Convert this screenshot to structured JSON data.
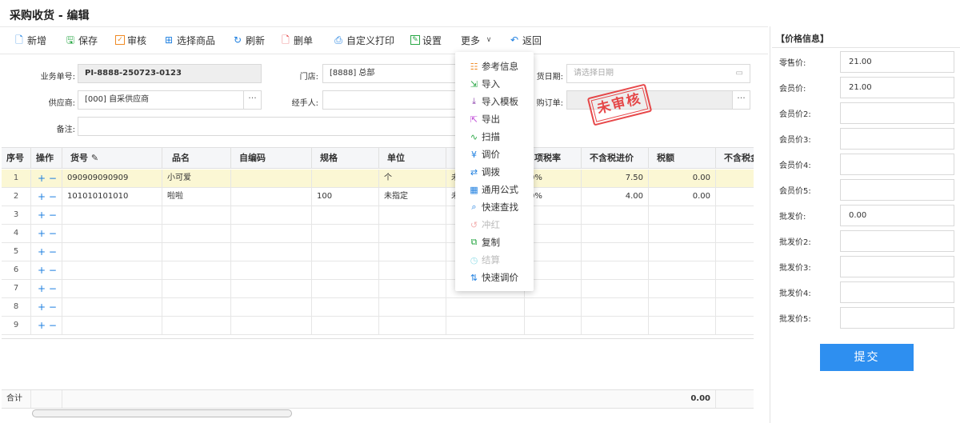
{
  "title": "采购收货 - 编辑",
  "toolbar": [
    {
      "label": "新增",
      "icon": "new-doc-icon",
      "color": "#1e7fe0"
    },
    {
      "label": "保存",
      "icon": "save-icon",
      "color": "#29a745"
    },
    {
      "label": "审核",
      "icon": "check-icon",
      "color": "#f08a24"
    },
    {
      "label": "选择商品",
      "icon": "cart-icon",
      "color": "#1e7fe0"
    },
    {
      "label": "刷新",
      "icon": "refresh-icon",
      "color": "#1e7fe0"
    },
    {
      "label": "删单",
      "icon": "delete-doc-icon",
      "color": "#e5393b"
    },
    {
      "label": "自定义打印",
      "icon": "print-icon",
      "color": "#1e7fe0"
    },
    {
      "label": "设置",
      "icon": "settings-icon",
      "color": "#29a745"
    },
    {
      "label": "更多",
      "icon": "chevron-down-icon",
      "color": "#555"
    },
    {
      "label": "返回",
      "icon": "back-icon",
      "color": "#1e7fe0"
    }
  ],
  "form": {
    "order_no": {
      "label": "业务单号:",
      "value": "PI-8888-250723-0123"
    },
    "store": {
      "label": "门店:",
      "value": "[8888] 总部"
    },
    "date": {
      "label": "货日期:",
      "placeholder": "请选择日期"
    },
    "supplier": {
      "label": "供应商:",
      "value": "[000] 自采供应商"
    },
    "handler": {
      "label": "经手人:",
      "value": ""
    },
    "purchase_order": {
      "label": "购订单:",
      "value": ""
    },
    "remark": {
      "label": "备注:",
      "value": ""
    },
    "dots": "···"
  },
  "stamp": "未审核",
  "grid": {
    "columns": [
      "序号",
      "操作",
      "货号",
      "品名",
      "自编码",
      "规格",
      "单位",
      "",
      "项税率",
      "不含税进价",
      "税额",
      "不含税金额"
    ],
    "edit_icon": "✎",
    "plus": "+",
    "minus": "−",
    "rows": [
      {
        "no": "1",
        "code": "090909090909",
        "name": "小可爱",
        "selfcode": "",
        "spec": "",
        "unit": "个",
        "col8": "未",
        "tax": "0%",
        "price": "7.50",
        "tax_amt": "0.00",
        "amount": ""
      },
      {
        "no": "2",
        "code": "101010101010",
        "name": "啦啦",
        "selfcode": "",
        "spec": "100",
        "unit": "未指定",
        "col8": "未",
        "tax": "0%",
        "price": "4.00",
        "tax_amt": "0.00",
        "amount": ""
      },
      {
        "no": "3"
      },
      {
        "no": "4"
      },
      {
        "no": "5"
      },
      {
        "no": "6"
      },
      {
        "no": "7"
      },
      {
        "no": "8"
      },
      {
        "no": "9"
      }
    ],
    "footer": {
      "label": "合计",
      "tax_total": "0.00"
    }
  },
  "more_menu": [
    {
      "label": "参考信息",
      "icon": "info-icon",
      "color": "#f08a24",
      "disabled": false
    },
    {
      "label": "导入",
      "icon": "import-icon",
      "color": "#29a745",
      "disabled": false
    },
    {
      "label": "导入模板",
      "icon": "download-icon",
      "color": "#8e44ad",
      "disabled": false
    },
    {
      "label": "导出",
      "icon": "export-icon",
      "color": "#c04cd8",
      "disabled": false
    },
    {
      "label": "扫描",
      "icon": "scan-icon",
      "color": "#29a745",
      "disabled": false
    },
    {
      "label": "调价",
      "icon": "adjust-price-icon",
      "color": "#1e7fe0",
      "disabled": false
    },
    {
      "label": "调拨",
      "icon": "transfer-icon",
      "color": "#1e7fe0",
      "disabled": false
    },
    {
      "label": "通用公式",
      "icon": "formula-icon",
      "color": "#1e7fe0",
      "disabled": false
    },
    {
      "label": "快速查找",
      "icon": "search-icon",
      "color": "#1e7fe0",
      "disabled": false
    },
    {
      "label": "冲红",
      "icon": "reverse-icon",
      "color": "#e5393b",
      "disabled": true
    },
    {
      "label": "复制",
      "icon": "copy-icon",
      "color": "#29a745",
      "disabled": false
    },
    {
      "label": "结算",
      "icon": "settle-icon",
      "color": "#4fc3d8",
      "disabled": true
    },
    {
      "label": "快速调价",
      "icon": "quick-adjust-icon",
      "color": "#1e7fe0",
      "disabled": false
    }
  ],
  "price_panel": {
    "header": "【价格信息】",
    "fields": [
      {
        "label": "零售价:",
        "value": "21.00"
      },
      {
        "label": "会员价:",
        "value": "21.00"
      },
      {
        "label": "会员价2:",
        "value": ""
      },
      {
        "label": "会员价3:",
        "value": ""
      },
      {
        "label": "会员价4:",
        "value": ""
      },
      {
        "label": "会员价5:",
        "value": ""
      },
      {
        "label": "批发价:",
        "value": "0.00"
      },
      {
        "label": "批发价2:",
        "value": ""
      },
      {
        "label": "批发价3:",
        "value": ""
      },
      {
        "label": "批发价4:",
        "value": ""
      },
      {
        "label": "批发价5:",
        "value": ""
      }
    ],
    "submit": "提交"
  }
}
